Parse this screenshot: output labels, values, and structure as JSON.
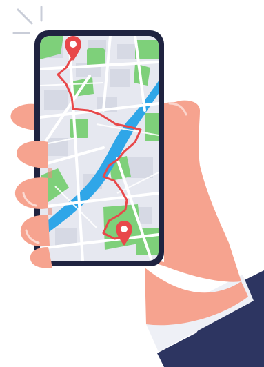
{
  "illustration": {
    "icons": {
      "hand": "hand-icon",
      "phone": "smartphone-icon",
      "start_pin": "map-pin-icon",
      "end_pin": "map-pin-icon",
      "route": "route-line-icon",
      "river": "river-icon",
      "sleeve": "suit-sleeve-icon",
      "spark": "spark-lines-icon"
    },
    "colors": {
      "phone_frame": "#1f2340",
      "map_background": "#e6e8f0",
      "map_park": "#7ed07a",
      "map_river": "#2fa6e8",
      "map_roads": "#ffffff",
      "route": "#e8484a",
      "pin": "#e8484a",
      "skin": "#f6a38f",
      "skin_shadow": "#e78e7b",
      "sleeve": "#2d3561",
      "cuff": "#eef0f6",
      "spark": "#c9cdd8"
    }
  }
}
